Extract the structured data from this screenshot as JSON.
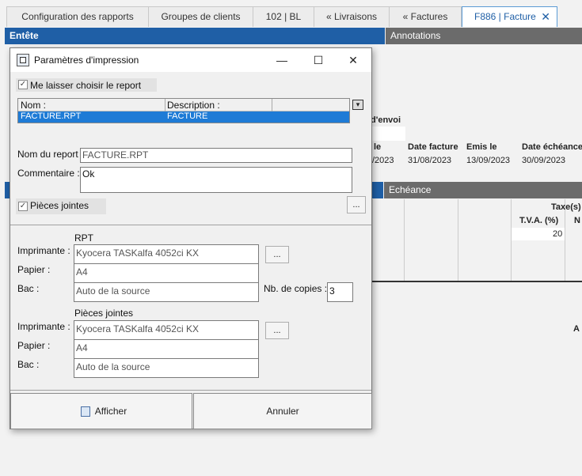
{
  "tabs": [
    {
      "label": "Configuration des rapports"
    },
    {
      "label": "Groupes de clients"
    },
    {
      "label": "102 | BL"
    },
    {
      "label": "« Livraisons"
    },
    {
      "label": "« Factures"
    },
    {
      "label": "F886 | Facture"
    }
  ],
  "tab_close": "✕",
  "background": {
    "entete": "Entête",
    "annotations": "Annotations",
    "echeance": "Echéance",
    "envoi_header": "d'envoi",
    "table_headers": [
      "le",
      "Date facture",
      "Emis le",
      "Date échéance"
    ],
    "table_row": [
      "/2023",
      "31/08/2023",
      "13/09/2023",
      "30/09/2023"
    ],
    "taxes_header": "Taxe(s)",
    "tva_header": "T.V.A. (%)",
    "tva_value": "20",
    "m_letter": "N",
    "a_letter": "A"
  },
  "dialog": {
    "title": "Paramètres d'impression",
    "minimize": "—",
    "maximize": "☐",
    "close": "✕",
    "let_choose_label": "Me laisser choisir le report",
    "list_headers": {
      "name": "Nom :",
      "description": "Description :"
    },
    "list_rows": [
      {
        "name": "FACTURE.RPT",
        "description": "FACTURE"
      }
    ],
    "report_name_label": "Nom du report :",
    "report_name_value": "FACTURE.RPT",
    "comment_label": "Commentaire :",
    "comment_value": "Ok",
    "attachments_label": "Pièces jointes",
    "ellipsis": "...",
    "rpt_section": "RPT",
    "printer_label": "Imprimante :",
    "printer_value": "Kyocera TASKalfa 4052ci KX",
    "paper_label": "Papier :",
    "paper_value": "A4",
    "tray_label": "Bac :",
    "tray_value": "Auto de la source",
    "copies_label": "Nb. de copies :",
    "copies_value": "3",
    "attach_section": "Pièces jointes",
    "attach_printer_value": "Kyocera TASKalfa 4052ci KX",
    "attach_paper_value": "A4",
    "attach_tray_value": "Auto de la source",
    "show_button": "Afficher",
    "cancel_button": "Annuler"
  },
  "colors": {
    "accent": "#1f5fa6",
    "header_bar": "#5a5a5a",
    "selection": "#1e7bd6"
  }
}
